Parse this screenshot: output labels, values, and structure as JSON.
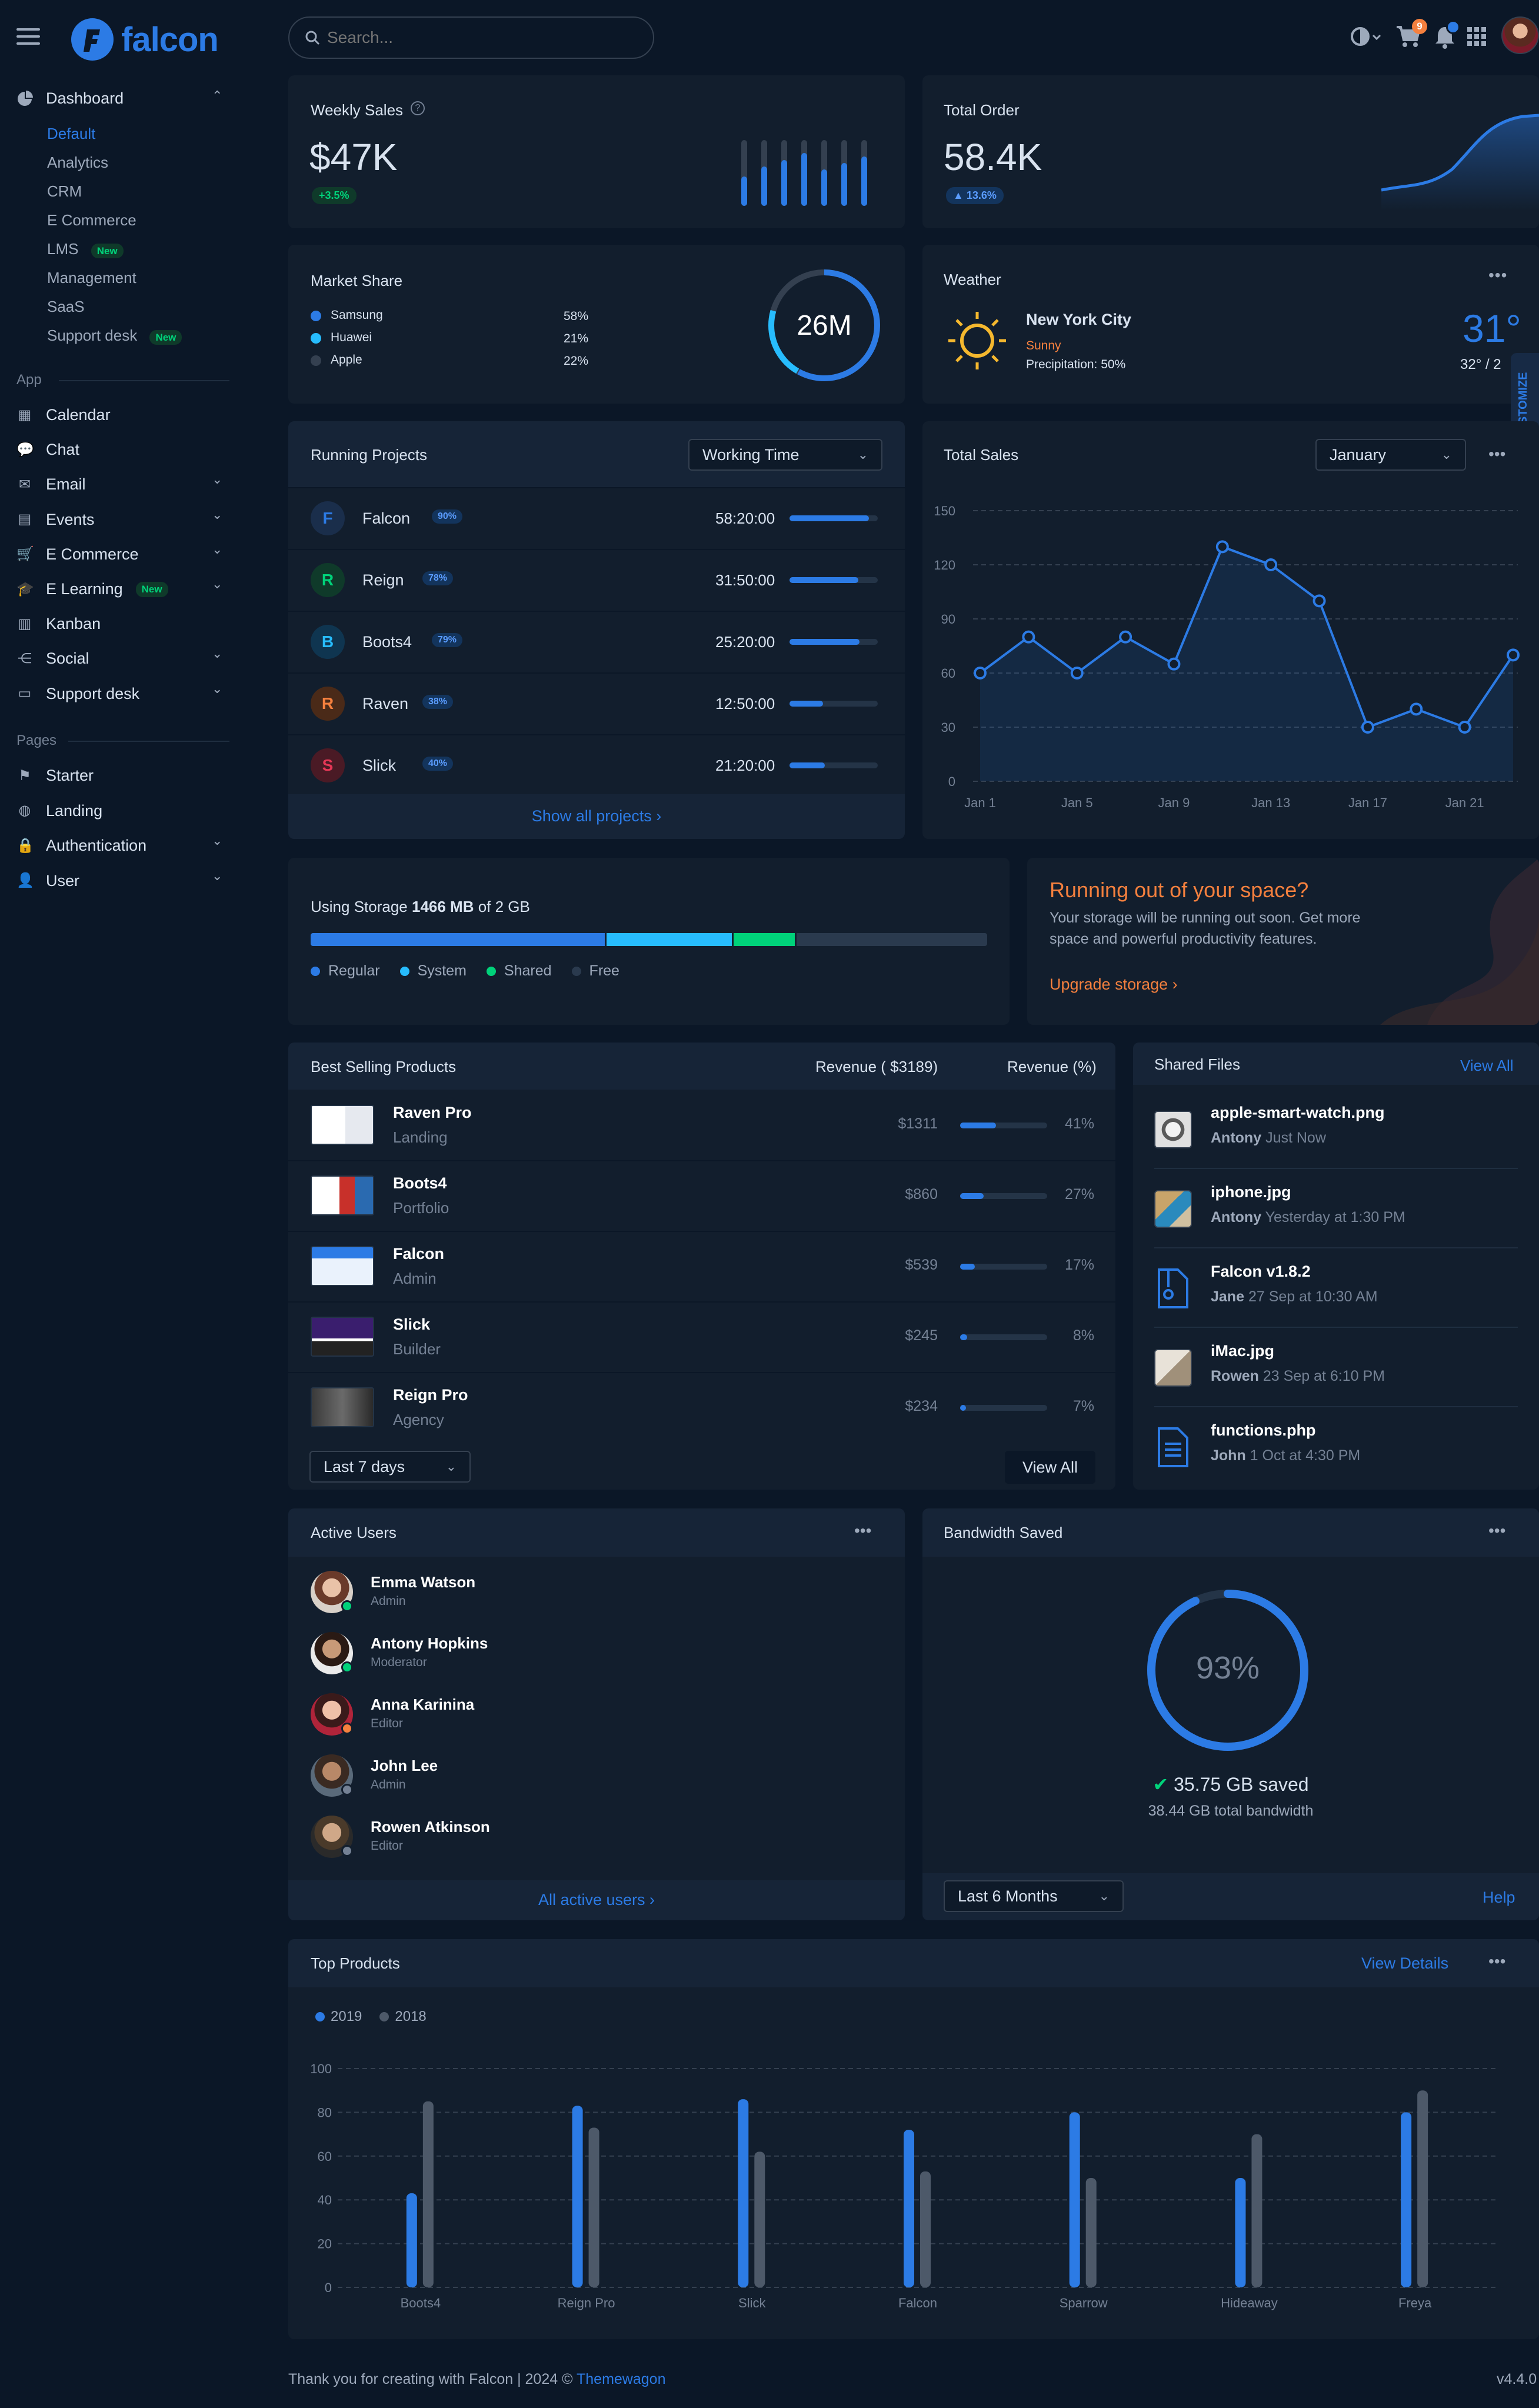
{
  "brand": {
    "name": "falcon"
  },
  "topbar": {
    "search_placeholder": "Search...",
    "cart_count": "9"
  },
  "sidebar": {
    "dashboard_label": "Dashboard",
    "dashboard_items": [
      {
        "label": "Default"
      },
      {
        "label": "Analytics"
      },
      {
        "label": "CRM"
      },
      {
        "label": "E Commerce"
      },
      {
        "label": "LMS",
        "badge": "New"
      },
      {
        "label": "Management"
      },
      {
        "label": "SaaS"
      },
      {
        "label": "Support desk",
        "badge": "New"
      }
    ],
    "app_heading": "App",
    "app_items": [
      {
        "label": "Calendar"
      },
      {
        "label": "Chat"
      },
      {
        "label": "Email"
      },
      {
        "label": "Events"
      },
      {
        "label": "E Commerce"
      },
      {
        "label": "E Learning",
        "badge": "New"
      },
      {
        "label": "Kanban"
      },
      {
        "label": "Social"
      },
      {
        "label": "Support desk"
      }
    ],
    "pages_heading": "Pages",
    "pages_items": [
      {
        "label": "Starter"
      },
      {
        "label": "Landing"
      },
      {
        "label": "Authentication"
      },
      {
        "label": "User"
      }
    ]
  },
  "weekly_sales": {
    "title": "Weekly Sales",
    "value": "$47K",
    "change": "+3.5%",
    "bars": [
      0.45,
      0.6,
      0.7,
      0.8,
      0.55,
      0.65,
      0.75
    ]
  },
  "total_order": {
    "title": "Total Order",
    "value": "58.4K",
    "change": "13.6%"
  },
  "market_share": {
    "title": "Market Share",
    "center": "26M",
    "items": [
      {
        "name": "Samsung",
        "pct": "58%",
        "color": "#2c7be5"
      },
      {
        "name": "Huawei",
        "pct": "21%",
        "color": "#27bcfd"
      },
      {
        "name": "Apple",
        "pct": "22%",
        "color": "#344050"
      }
    ]
  },
  "weather": {
    "title": "Weather",
    "city": "New York City",
    "condition": "Sunny",
    "precip": "Precipitation: 50%",
    "temp": "31°",
    "range": "32° / 2"
  },
  "customize": {
    "label": "CUSTOMIZE"
  },
  "running_projects": {
    "title": "Running Projects",
    "dropdown": "Working Time",
    "show_all": "Show all projects ›",
    "items": [
      {
        "letter": "F",
        "name": "Falcon",
        "pct": "90%",
        "time": "58:20:00",
        "progress": 0.9,
        "color": "#2c7be5",
        "bg": "#1a2e4b"
      },
      {
        "letter": "R",
        "name": "Reign",
        "pct": "78%",
        "time": "31:50:00",
        "progress": 0.78,
        "color": "#00d27a",
        "bg": "#0f3a2a"
      },
      {
        "letter": "B",
        "name": "Boots4",
        "pct": "79%",
        "time": "25:20:00",
        "progress": 0.79,
        "color": "#27bcfd",
        "bg": "#0f3550"
      },
      {
        "letter": "R",
        "name": "Raven",
        "pct": "38%",
        "time": "12:50:00",
        "progress": 0.38,
        "color": "#f5803e",
        "bg": "#4a2a18"
      },
      {
        "letter": "S",
        "name": "Slick",
        "pct": "40%",
        "time": "21:20:00",
        "progress": 0.4,
        "color": "#e63757",
        "bg": "#4a1a25"
      }
    ]
  },
  "total_sales": {
    "title": "Total Sales",
    "dropdown": "January"
  },
  "chart_data": {
    "type": "line",
    "title": "Total Sales",
    "x": [
      "Jan 1",
      "Jan 3",
      "Jan 5",
      "Jan 7",
      "Jan 9",
      "Jan 11",
      "Jan 13",
      "Jan 15",
      "Jan 17",
      "Jan 19",
      "Jan 21",
      "Jan 23"
    ],
    "x_tick_labels": [
      "Jan 1",
      "Jan 5",
      "Jan 9",
      "Jan 13",
      "Jan 17",
      "Jan 21"
    ],
    "values": [
      60,
      80,
      60,
      80,
      65,
      130,
      120,
      100,
      30,
      40,
      30,
      70
    ],
    "yticks": [
      0,
      30,
      60,
      90,
      120,
      150
    ],
    "ylim": [
      0,
      150
    ],
    "grid": true
  },
  "storage": {
    "label_pre": "Using Storage ",
    "used": "1466 MB",
    "label_post": " of 2 GB",
    "segments": [
      {
        "name": "Regular",
        "color": "#2c7be5",
        "frac": 0.435
      },
      {
        "name": "System",
        "color": "#27bcfd",
        "frac": 0.185
      },
      {
        "name": "Shared",
        "color": "#00d27a",
        "frac": 0.09
      },
      {
        "name": "Free",
        "color": "#2a3a4e",
        "frac": 0.29
      }
    ]
  },
  "space_alert": {
    "title": "Running out of your space?",
    "text1": "Your storage will be running out soon. Get more",
    "text2": "space and powerful productivity features.",
    "link": "Upgrade storage ›"
  },
  "best_selling": {
    "title": "Best Selling Products",
    "col_revenue": "Revenue ( $3189)",
    "col_pct": "Revenue (%)",
    "items": [
      {
        "name": "Raven Pro",
        "cat": "Landing",
        "rev": "$1311",
        "pct": "41%",
        "frac": 0.41
      },
      {
        "name": "Boots4",
        "cat": "Portfolio",
        "rev": "$860",
        "pct": "27%",
        "frac": 0.27
      },
      {
        "name": "Falcon",
        "cat": "Admin",
        "rev": "$539",
        "pct": "17%",
        "frac": 0.17
      },
      {
        "name": "Slick",
        "cat": "Builder",
        "rev": "$245",
        "pct": "8%",
        "frac": 0.08
      },
      {
        "name": "Reign Pro",
        "cat": "Agency",
        "rev": "$234",
        "pct": "7%",
        "frac": 0.07
      }
    ],
    "dropdown": "Last 7 days",
    "view_all": "View All"
  },
  "shared_files": {
    "title": "Shared Files",
    "view_all": "View All",
    "items": [
      {
        "name": "apple-smart-watch.png",
        "user": "Antony",
        "time": "Just Now"
      },
      {
        "name": "iphone.jpg",
        "user": "Antony",
        "time": "Yesterday at 1:30 PM"
      },
      {
        "name": "Falcon v1.8.2",
        "user": "Jane",
        "time": "27 Sep at 10:30 AM"
      },
      {
        "name": "iMac.jpg",
        "user": "Rowen",
        "time": "23 Sep at 6:10 PM"
      },
      {
        "name": "functions.php",
        "user": "John",
        "time": "1 Oct at 4:30 PM"
      }
    ]
  },
  "active_users": {
    "title": "Active Users",
    "footer": "All active users ›",
    "items": [
      {
        "name": "Emma Watson",
        "role": "Admin",
        "status": "#00d27a"
      },
      {
        "name": "Antony Hopkins",
        "role": "Moderator",
        "status": "#00d27a"
      },
      {
        "name": "Anna Karinina",
        "role": "Editor",
        "status": "#f5803e"
      },
      {
        "name": "John Lee",
        "role": "Admin",
        "status": "#748194"
      },
      {
        "name": "Rowen Atkinson",
        "role": "Editor",
        "status": "#748194"
      }
    ]
  },
  "bandwidth": {
    "title": "Bandwidth Saved",
    "pct": "93%",
    "pct_value": 0.93,
    "saved": "35.75 GB saved",
    "total": "38.44 GB total bandwidth",
    "dropdown": "Last 6 Months",
    "help": "Help"
  },
  "top_products": {
    "title": "Top Products",
    "view_details": "View Details"
  },
  "chart_data_2": {
    "type": "bar",
    "categories": [
      "Boots4",
      "Reign Pro",
      "Slick",
      "Falcon",
      "Sparrow",
      "Hideaway",
      "Freya"
    ],
    "series": [
      {
        "name": "2019",
        "color": "#2c7be5",
        "values": [
          43,
          83,
          86,
          72,
          80,
          50,
          80
        ]
      },
      {
        "name": "2018",
        "color": "#4d5969",
        "values": [
          85,
          73,
          62,
          53,
          50,
          70,
          90
        ]
      }
    ],
    "yticks": [
      0,
      20,
      40,
      60,
      80,
      100
    ],
    "ylim": [
      0,
      100
    ]
  },
  "footer": {
    "text": "Thank you for creating with Falcon | 2024 © ",
    "link": "Themewagon",
    "version": "v4.4.0"
  }
}
